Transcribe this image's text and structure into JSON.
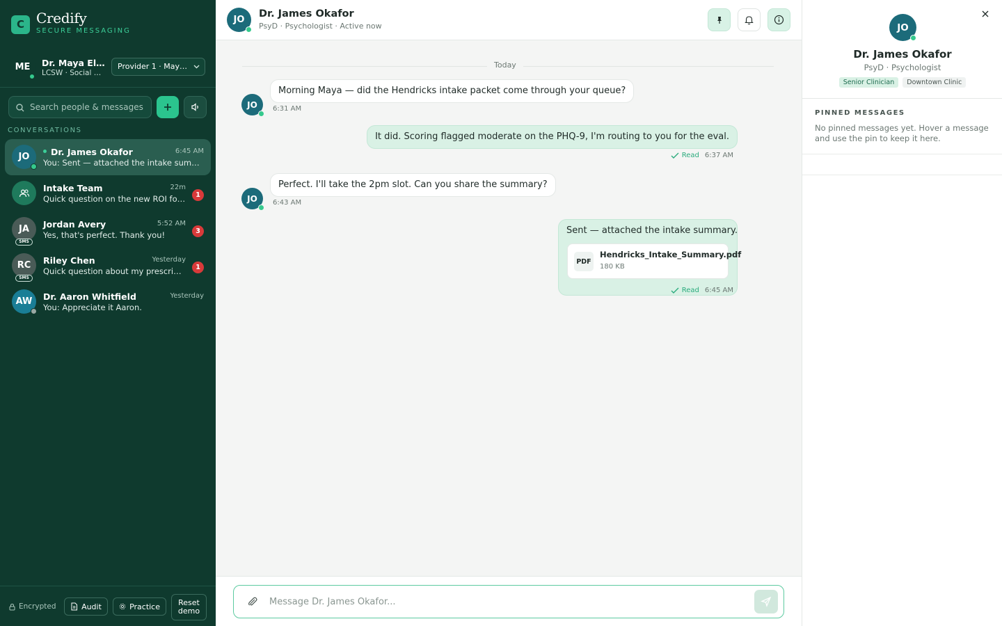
{
  "brand": {
    "logo_letter": "C",
    "name": "Credify",
    "subtitle": "SECURE MESSAGING"
  },
  "me": {
    "initials": "ME",
    "name": "Dr. Maya Elli...",
    "role": "LCSW · Social W...",
    "provider_select": "Provider 1 · Maya El..."
  },
  "search": {
    "placeholder": "Search people & messages"
  },
  "sidebar": {
    "conversations_label": "CONVERSATIONS",
    "conversations": [
      {
        "initials": "JO",
        "name": "Dr. James Okafor",
        "time": "6:45 AM",
        "preview": "You: Sent — attached the intake summary.",
        "avatar_color": "#1c6b7a",
        "status": "online",
        "active": true
      },
      {
        "icon": "group-icon",
        "name": "Intake Team",
        "time": "22m",
        "preview": "Quick question on the new ROI for...",
        "unread": "1",
        "avatar_color": "#1f7a5c"
      },
      {
        "initials": "JA",
        "name": "Jordan Avery",
        "time": "5:52 AM",
        "preview": "Yes, that's perfect. Thank you!",
        "unread": "3",
        "tag": "SMS",
        "avatar_color": "#4a5b57"
      },
      {
        "initials": "RC",
        "name": "Riley Chen",
        "time": "Yesterday",
        "preview": "Quick question about my prescripti...",
        "unread": "1",
        "tag": "SMS",
        "avatar_color": "#4a5b57"
      },
      {
        "initials": "AW",
        "name": "Dr. Aaron Whitfield",
        "time": "Yesterday",
        "preview": "You: Appreciate it Aaron.",
        "avatar_color": "#1a7e96",
        "status": "offline"
      }
    ]
  },
  "footer": {
    "encrypted": "Encrypted",
    "audit": "Audit",
    "practice": "Practice",
    "reset_line1": "Reset",
    "reset_line2": "demo"
  },
  "chat": {
    "contact_initials": "JO",
    "contact_name": "Dr. James Okafor",
    "contact_sub": "PsyD · Psychologist · Active now",
    "day_label": "Today",
    "messages": [
      {
        "direction": "in",
        "text": "Morning Maya — did the Hendricks intake packet come through your queue?",
        "time": "6:31 AM"
      },
      {
        "direction": "out",
        "text": "It did. Scoring flagged moderate on the PHQ-9, I'm routing to you for the eval.",
        "status": "Read",
        "time": "6:37 AM"
      },
      {
        "direction": "in",
        "text": "Perfect. I'll take the 2pm slot. Can you share the summary?",
        "time": "6:43 AM"
      },
      {
        "direction": "out",
        "text": "Sent — attached the intake summary.",
        "status": "Read",
        "time": "6:45 AM",
        "attachment": {
          "type": "PDF",
          "name": "Hendricks_Intake_Summary.pdf",
          "size": "180 KB"
        }
      }
    ],
    "composer_placeholder": "Message Dr. James Okafor..."
  },
  "details": {
    "initials": "JO",
    "name": "Dr. James Okafor",
    "role": "PsyD · Psychologist",
    "tags": [
      "Senior Clinician",
      "Downtown Clinic"
    ],
    "pinned_title": "PINNED MESSAGES",
    "pinned_empty": "No pinned messages yet. Hover a message and use the pin to keep it here."
  },
  "colors": {
    "sidebar_bg": "#0f3a2e",
    "accent": "#2bc48e",
    "bubble_out": "#d9f1e5",
    "unread_badge": "#d83a3a"
  }
}
